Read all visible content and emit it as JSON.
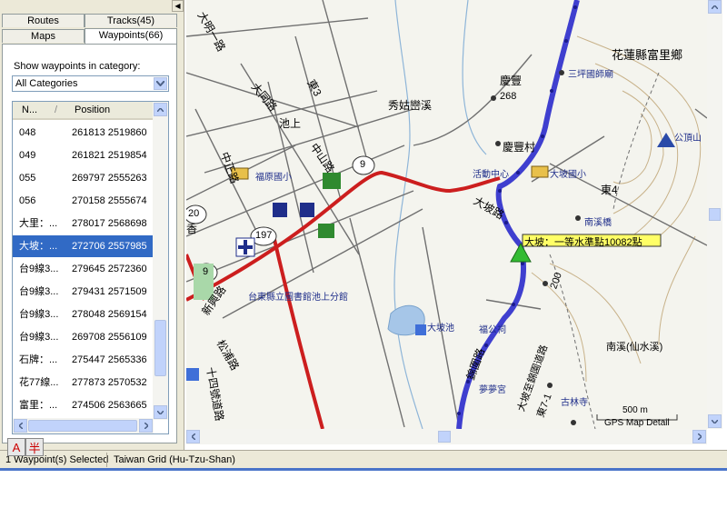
{
  "tabs": {
    "routes": "Routes",
    "tracks": "Tracks(45)",
    "maps": "Maps",
    "waypoints": "Waypoints(66)"
  },
  "category": {
    "label": "Show waypoints in category:",
    "selected": "All Categories"
  },
  "list": {
    "col_name": "N...",
    "col_sort": "/",
    "col_position": "Position",
    "rows": [
      {
        "name": "048",
        "pos": "261813 2519860"
      },
      {
        "name": "049",
        "pos": "261821 2519854"
      },
      {
        "name": "055",
        "pos": "269797 2555263"
      },
      {
        "name": "056",
        "pos": "270158 2555674"
      },
      {
        "name": "大里：...",
        "pos": "278017 2568698"
      },
      {
        "name": "大坡：...",
        "pos": "272706 2557985",
        "selected": true
      },
      {
        "name": "台9線3...",
        "pos": "279645 2572360"
      },
      {
        "name": "台9線3...",
        "pos": "279431 2571509"
      },
      {
        "name": "台9線3...",
        "pos": "278048 2569154"
      },
      {
        "name": "台9線3...",
        "pos": "269708 2556109"
      },
      {
        "name": "石牌：...",
        "pos": "275447 2565336"
      },
      {
        "name": "花77線...",
        "pos": "277873 2570532"
      },
      {
        "name": "富里：...",
        "pos": "274506 2563665"
      }
    ]
  },
  "map": {
    "labels": {
      "township": "花蓮縣富里鄉",
      "road_daming": "大明一路",
      "road_datong": "大同路",
      "road_dong3": "東3",
      "pond": "池上",
      "creek": "秀姑巒溪",
      "qingfeng": "慶豐",
      "elev268": "268",
      "sanping": "三坪國師廟",
      "qingfeng_village": "慶豐村",
      "gongding": "公頂山",
      "activity": "活動中心",
      "dapo_school": "大坡國小",
      "dong4": "東4",
      "route9": "9",
      "route20": "20",
      "route197": "197",
      "zhongshan": "中山路",
      "zhongzheng": "中正路",
      "fuyuan": "福原國小",
      "dapo_road": "大坡路",
      "nanxi_bridge": "南溪橋",
      "dapo_marker": "大坡：一等水準點10082點",
      "library": "台東縣立圖書館池上分館",
      "dapo_pond": "大坡池",
      "fugong": "福公祠",
      "jiansi": "錦圍路",
      "road200": "200",
      "nanxi": "南溪(仙水溪)",
      "xiang": "香",
      "xinsheng": "新興路",
      "songpu": "松浦路",
      "dong71": "東7-1",
      "jinlin": "大坡至錦園道路",
      "fumeng": "夢夢宮",
      "gulin": "古林寺",
      "jiangong": "十四號道路",
      "scale": "500 m",
      "detail": "GPS Map Detail"
    }
  },
  "status": {
    "selected": "1 Waypoint(s) Selected",
    "grid": "Taiwan Grid (Hu-Tzu-Shan)"
  },
  "ime": {
    "a": "A",
    "half": "半"
  }
}
